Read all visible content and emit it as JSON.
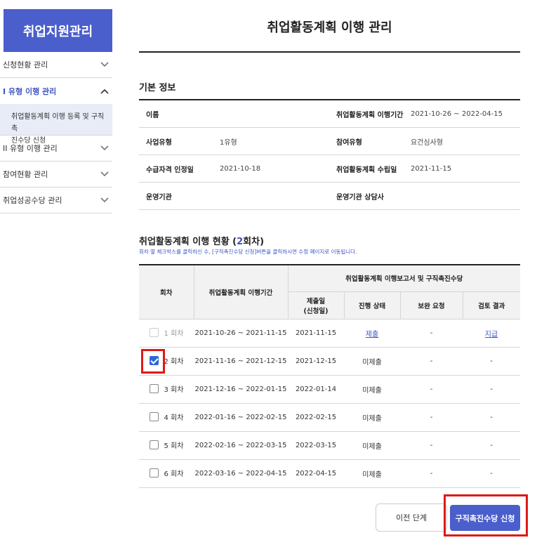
{
  "sidebar": {
    "title": "취업지원관리",
    "items": [
      {
        "label": "신청현황 관리",
        "chevron": "chevron-down-icon"
      },
      {
        "label": "I 유형 이행 관리",
        "chevron": "chevron-up-icon",
        "active": true
      },
      {
        "label": "II 유형 이행 관리",
        "chevron": "chevron-down-icon"
      },
      {
        "label": "참여현황 관리",
        "chevron": "chevron-down-icon"
      },
      {
        "label": "취업성공수당 관리",
        "chevron": "chevron-down-icon"
      }
    ],
    "submenu": {
      "line1": "취업활동계획 이행 등록 및 구직촉",
      "line2": "진수당 신청"
    }
  },
  "page": {
    "title": "취업활동계획 이행 관리"
  },
  "basic_info": {
    "title": "기본 정보",
    "rows": [
      {
        "l1": "이름",
        "v1": "",
        "l2": "취업활동계획 이행기간",
        "v2": "2021-10-26 ~ 2022-04-15"
      },
      {
        "l1": "사업유형",
        "v1": "1유형",
        "l2": "참여유형",
        "v2": "요건심사형"
      },
      {
        "l1": "수급자격 인정일",
        "v1": "2021-10-18",
        "l2": "취업활동계획 수립일",
        "v2": "2021-11-15"
      },
      {
        "l1": "운영기관",
        "v1": "",
        "l2": "운영기관 상담사",
        "v2": ""
      }
    ]
  },
  "plan": {
    "title_prefix": "취업활동계획 이행 현황 (",
    "title_count": "2",
    "title_suffix": "회차)",
    "note": "회차 옆 체크박스를 클릭하신 수, [구직촉진수당 신청]버튼을 클릭하시면 수정 페이지로 이동됩니다.",
    "headers": {
      "round": "회차",
      "period": "취업활동계획 이행기간",
      "report_group": "취업활동계획 이행보고서 및 구직촉진수당",
      "submit_date_1": "제출일",
      "submit_date_2": "(신청일)",
      "status": "진행 상태",
      "supplement": "보완 요청",
      "review": "검토 결과"
    },
    "rows": [
      {
        "round": "1 회차",
        "period": "2021-10-26 ~ 2021-11-15",
        "submit": "2021-11-15",
        "status": "제출",
        "status_link": true,
        "supplement": "-",
        "review": "지급",
        "review_link": true,
        "checkbox": "disabled"
      },
      {
        "round": "2 회차",
        "period": "2021-11-16 ~ 2021-12-15",
        "submit": "2021-12-15",
        "status": "미제출",
        "status_link": false,
        "supplement": "-",
        "review": "-",
        "review_link": false,
        "checkbox": "checked"
      },
      {
        "round": "3 회차",
        "period": "2021-12-16 ~ 2022-01-15",
        "submit": "2022-01-14",
        "status": "미제출",
        "status_link": false,
        "supplement": "-",
        "review": "-",
        "review_link": false,
        "checkbox": "unchecked"
      },
      {
        "round": "4 회차",
        "period": "2022-01-16 ~ 2022-02-15",
        "submit": "2022-02-15",
        "status": "미제출",
        "status_link": false,
        "supplement": "-",
        "review": "-",
        "review_link": false,
        "checkbox": "unchecked"
      },
      {
        "round": "5 회차",
        "period": "2022-02-16 ~ 2022-03-15",
        "submit": "2022-03-15",
        "status": "미제출",
        "status_link": false,
        "supplement": "-",
        "review": "-",
        "review_link": false,
        "checkbox": "unchecked"
      },
      {
        "round": "6 회차",
        "period": "2022-03-16 ~ 2022-04-15",
        "submit": "2022-04-15",
        "status": "미제출",
        "status_link": false,
        "supplement": "-",
        "review": "-",
        "review_link": false,
        "checkbox": "unchecked"
      }
    ]
  },
  "buttons": {
    "prev": "이전 단계",
    "apply": "구직촉진수당 신청"
  },
  "colors": {
    "accent": "#4a5fcc",
    "highlight": "#e01818",
    "link": "#3d54c4"
  }
}
